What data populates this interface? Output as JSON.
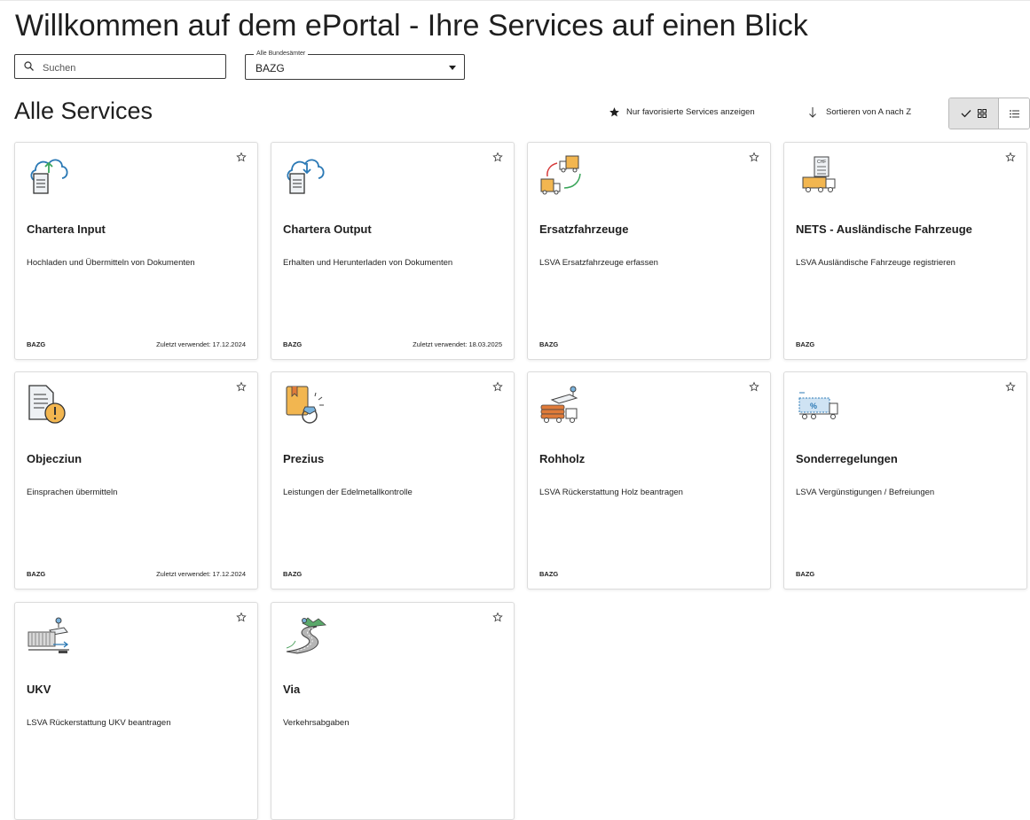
{
  "page": {
    "title": "Willkommen auf dem ePortal - Ihre Services auf einen Blick"
  },
  "search": {
    "placeholder": "Suchen",
    "icon": "search-icon"
  },
  "office_select": {
    "label": "Alle Bundesämter",
    "value": "BAZG"
  },
  "section": {
    "title": "Alle Services"
  },
  "toolbar": {
    "favorites_label": "Nur favorisierte Services anzeigen",
    "sort_label": "Sortieren von A nach Z",
    "view_mode": "grid"
  },
  "services": [
    {
      "title": "Chartera Input",
      "description": "Hochladen und Übermitteln von Dokumenten",
      "org": "BAZG",
      "last_used": "Zuletzt verwendet: 17.12.2024",
      "icon": "cloud-upload-icon"
    },
    {
      "title": "Chartera Output",
      "description": "Erhalten und Herunterladen von Dokumenten",
      "org": "BAZG",
      "last_used": "Zuletzt verwendet: 18.03.2025",
      "icon": "cloud-download-icon"
    },
    {
      "title": "Ersatzfahrzeuge",
      "description": "LSVA Ersatzfahrzeuge erfassen",
      "org": "BAZG",
      "last_used": "",
      "icon": "truck-swap-icon"
    },
    {
      "title": "NETS - Ausländische Fahrzeuge",
      "description": "LSVA Ausländische Fahrzeuge registrieren",
      "org": "BAZG",
      "last_used": "",
      "icon": "truck-document-icon"
    },
    {
      "title": "Objecziun",
      "description": "Einsprachen übermitteln",
      "org": "BAZG",
      "last_used": "Zuletzt verwendet: 17.12.2024",
      "icon": "document-warning-icon"
    },
    {
      "title": "Prezius",
      "description": "Leistungen der Edelmetallkontrolle",
      "org": "BAZG",
      "last_used": "",
      "icon": "ring-certificate-icon"
    },
    {
      "title": "Rohholz",
      "description": "LSVA Rückerstattung Holz beantragen",
      "org": "BAZG",
      "last_used": "",
      "icon": "timber-truck-icon"
    },
    {
      "title": "Sonderregelungen",
      "description": "LSVA Vergünstigungen / Befreiungen",
      "org": "BAZG",
      "last_used": "",
      "icon": "truck-discount-icon"
    },
    {
      "title": "UKV",
      "description": "LSVA Rückerstattung UKV beantragen",
      "org": "",
      "last_used": "",
      "icon": "rail-transport-icon"
    },
    {
      "title": "Via",
      "description": "Verkehrsabgaben",
      "org": "",
      "last_used": "",
      "icon": "road-icon"
    }
  ]
}
